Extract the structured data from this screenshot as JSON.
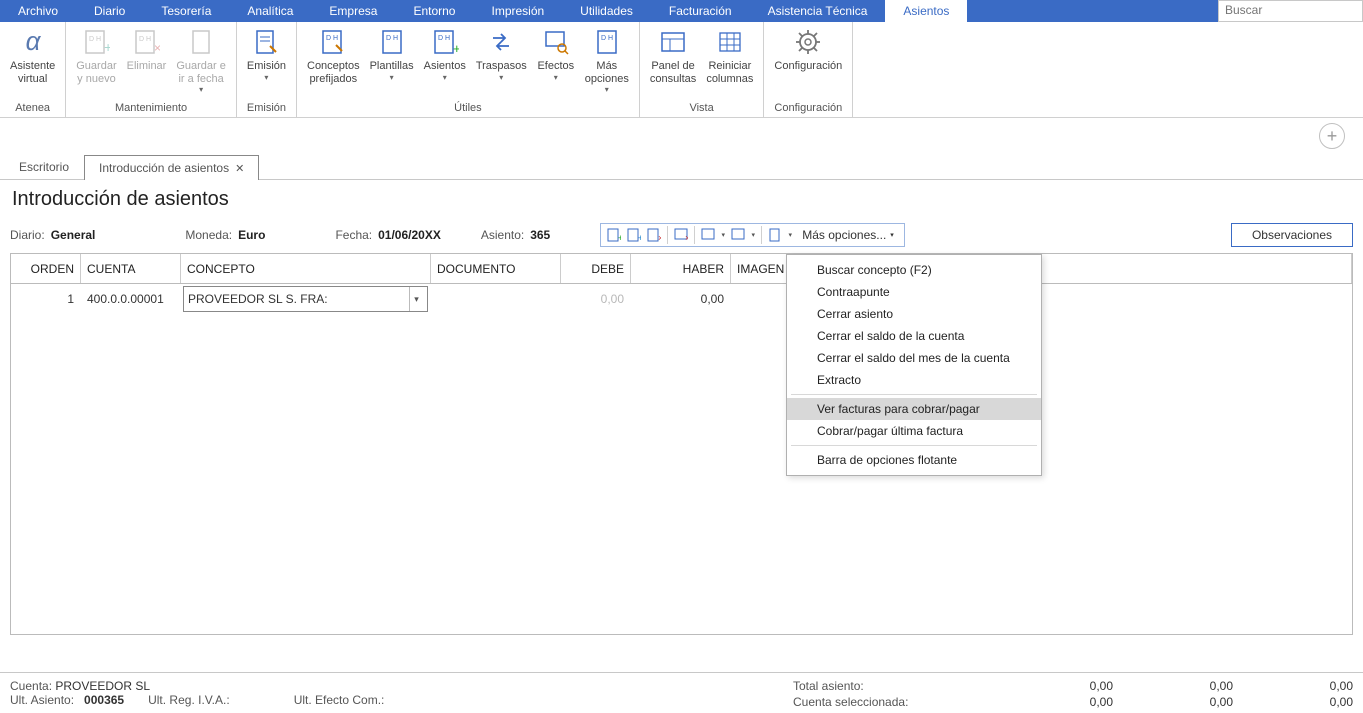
{
  "menu": {
    "items": [
      "Archivo",
      "Diario",
      "Tesorería",
      "Analítica",
      "Empresa",
      "Entorno",
      "Impresión",
      "Utilidades",
      "Facturación",
      "Asistencia Técnica",
      "Asientos"
    ],
    "active": "Asientos",
    "search_placeholder": "Buscar"
  },
  "ribbon": {
    "groups": [
      {
        "name": "Atenea",
        "buttons": [
          {
            "id": "asistente",
            "label": "Asistente\nvirtual",
            "icon": "alpha",
            "disabled": false
          }
        ]
      },
      {
        "name": "Mantenimiento",
        "buttons": [
          {
            "id": "guardar-nuevo",
            "label": "Guardar\ny nuevo",
            "icon": "doc-plus",
            "disabled": true
          },
          {
            "id": "eliminar",
            "label": "Eliminar",
            "icon": "doc-x",
            "disabled": true
          },
          {
            "id": "guardar-fecha",
            "label": "Guardar e\nir a fecha",
            "icon": "doc-blank",
            "disabled": true,
            "dd": true
          }
        ]
      },
      {
        "name": "Emisión",
        "buttons": [
          {
            "id": "emision",
            "label": "Emisión",
            "icon": "doc-pen",
            "disabled": false,
            "dd": true
          }
        ]
      },
      {
        "name": "Útiles",
        "buttons": [
          {
            "id": "conceptos",
            "label": "Conceptos\nprefijados",
            "icon": "doc-dh-pen",
            "disabled": false
          },
          {
            "id": "plantillas",
            "label": "Plantillas",
            "icon": "doc-dh",
            "disabled": false,
            "dd": true
          },
          {
            "id": "asientos",
            "label": "Asientos",
            "icon": "doc-dh-plus",
            "disabled": false,
            "dd": true
          },
          {
            "id": "traspasos",
            "label": "Traspasos",
            "icon": "arrows",
            "disabled": false,
            "dd": true
          },
          {
            "id": "efectos",
            "label": "Efectos",
            "icon": "doc-search",
            "disabled": false,
            "dd": true
          },
          {
            "id": "mas",
            "label": "Más\nopciones",
            "icon": "doc-dh",
            "disabled": false,
            "dd": true
          }
        ]
      },
      {
        "name": "Vista",
        "buttons": [
          {
            "id": "panel",
            "label": "Panel de\nconsultas",
            "icon": "panel",
            "disabled": false
          },
          {
            "id": "reiniciar",
            "label": "Reiniciar\ncolumnas",
            "icon": "grid",
            "disabled": false
          }
        ]
      },
      {
        "name": "Configuración",
        "buttons": [
          {
            "id": "config",
            "label": "Configuración",
            "icon": "gear",
            "disabled": false
          }
        ]
      }
    ]
  },
  "tabs": {
    "items": [
      {
        "label": "Escritorio",
        "close": false
      },
      {
        "label": "Introducción de asientos",
        "close": true,
        "active": true
      }
    ]
  },
  "page": {
    "title": "Introducción de asientos",
    "diario_k": "Diario:",
    "diario_v": "General",
    "moneda_k": "Moneda:",
    "moneda_v": "Euro",
    "fecha_k": "Fecha:",
    "fecha_v": "01/06/20XX",
    "asiento_k": "Asiento:",
    "asiento_v": "365",
    "mas_opciones": "Más opciones...",
    "observaciones": "Observaciones"
  },
  "grid": {
    "headers": {
      "orden": "ORDEN",
      "cuenta": "CUENTA",
      "concepto": "CONCEPTO",
      "documento": "DOCUMENTO",
      "debe": "DEBE",
      "haber": "HABER",
      "imagen": "IMAGEN"
    },
    "row": {
      "orden": "1",
      "cuenta": "400.0.0.00001",
      "concepto": "PROVEEDOR SL S. FRA:",
      "debe": "0,00",
      "haber": "0,00"
    }
  },
  "dropdown": {
    "items": [
      "Buscar concepto (F2)",
      "Contraapunte",
      "Cerrar asiento",
      "Cerrar el saldo de la cuenta",
      "Cerrar el saldo del mes de la cuenta",
      "Extracto",
      "Ver facturas para cobrar/pagar",
      "Cobrar/pagar última factura",
      "Barra de opciones flotante"
    ],
    "highlighted": "Ver facturas para cobrar/pagar"
  },
  "footer": {
    "cuenta_k": "Cuenta:",
    "cuenta_v": "PROVEEDOR SL",
    "ultasiento_k": "Ult. Asiento:",
    "ultasiento_v": "000365",
    "ultreg": "Ult. Reg. I.V.A.:",
    "ultefecto": "Ult. Efecto Com.:",
    "total_k": "Total asiento:",
    "cuenta_sel_k": "Cuenta seleccionada:",
    "v1": "0,00",
    "v2": "0,00",
    "v3": "0,00"
  }
}
